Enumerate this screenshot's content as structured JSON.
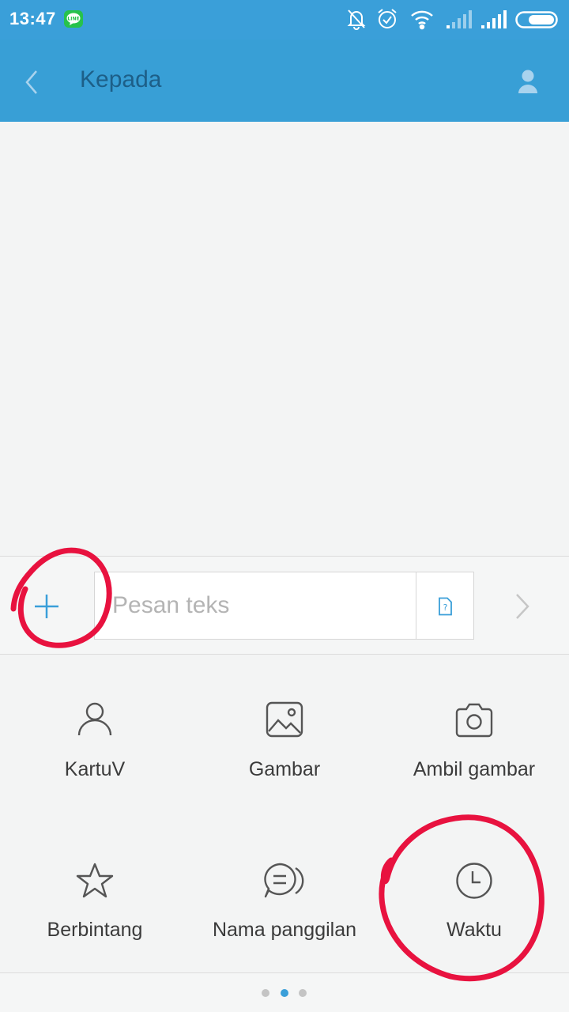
{
  "status_bar": {
    "time": "13:47",
    "icons": [
      "line-app-icon",
      "notifications-off-icon",
      "alarm-icon",
      "wifi-icon",
      "signal-weak-icon",
      "signal-full-icon",
      "battery-icon"
    ]
  },
  "app_bar": {
    "title": "Kepada",
    "back_icon": "chevron-left-icon",
    "contact_icon": "person-icon",
    "background": "#389fd6",
    "title_color": "#1d5f88"
  },
  "composer": {
    "placeholder": "Pesan teks",
    "value": "",
    "add_icon": "plus-icon",
    "sim_icon": "sim-card-icon",
    "send_icon": "chevron-right-icon"
  },
  "attachments": [
    {
      "label": "KartuV",
      "icon": "person-icon"
    },
    {
      "label": "Gambar",
      "icon": "image-icon"
    },
    {
      "label": "Ambil gambar",
      "icon": "camera-icon"
    },
    {
      "label": "Berbintang",
      "icon": "star-icon"
    },
    {
      "label": "Nama panggilan",
      "icon": "chat-bubble-icon"
    },
    {
      "label": "Waktu",
      "icon": "clock-icon"
    }
  ],
  "pager": {
    "pages": 3,
    "current": 2
  },
  "annotations": {
    "color": "#e8123f",
    "circled": [
      "add-button",
      "Waktu"
    ]
  }
}
